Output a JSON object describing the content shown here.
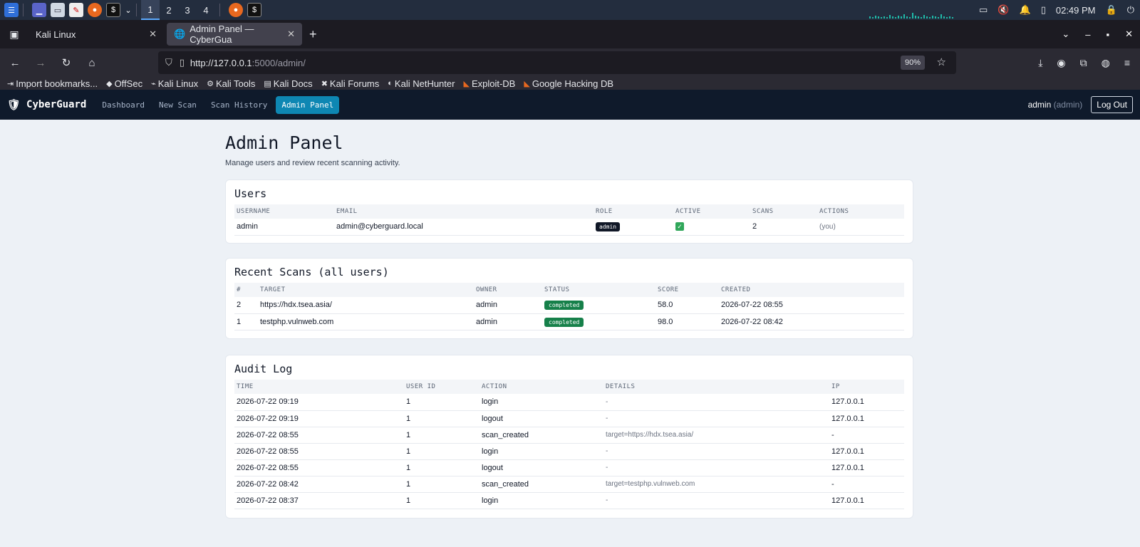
{
  "taskbar": {
    "workspaces": [
      "1",
      "2",
      "3",
      "4"
    ],
    "clock": "02:49 PM",
    "icons": [
      "kali-menu-icon",
      "desktop-icon",
      "file-manager-icon",
      "text-editor-icon",
      "firefox-icon",
      "terminal-icon"
    ]
  },
  "browser": {
    "tabs": [
      {
        "title": "Kali Linux"
      },
      {
        "title": "Admin Panel — CyberGua"
      }
    ],
    "url_host": "http://127.0.0.1",
    "url_rest": ":5000/admin/",
    "zoom": "90%",
    "bookmarks": [
      "Import bookmarks...",
      "OffSec",
      "Kali Linux",
      "Kali Tools",
      "Kali Docs",
      "Kali Forums",
      "Kali NetHunter",
      "Exploit-DB",
      "Google Hacking DB"
    ]
  },
  "app": {
    "brand": "CyberGuard",
    "nav": [
      "Dashboard",
      "New Scan",
      "Scan History",
      "Admin Panel"
    ],
    "user": "admin",
    "user_role": "(admin)",
    "logout": "Log Out"
  },
  "page": {
    "title": "Admin Panel",
    "subtitle": "Manage users and review recent scanning activity."
  },
  "users": {
    "heading": "Users",
    "columns": [
      "USERNAME",
      "EMAIL",
      "ROLE",
      "ACTIVE",
      "SCANS",
      "ACTIONS"
    ],
    "rows": [
      {
        "username": "admin",
        "email": "admin@cyberguard.local",
        "role": "admin",
        "active": "✓",
        "scans": "2",
        "actions": "(you)"
      }
    ]
  },
  "scans": {
    "heading": "Recent Scans (all users)",
    "columns": [
      "#",
      "TARGET",
      "OWNER",
      "STATUS",
      "SCORE",
      "CREATED"
    ],
    "rows": [
      {
        "id": "2",
        "target": "https://hdx.tsea.asia/",
        "owner": "admin",
        "status": "completed",
        "score": "58.0",
        "created": "2026-07-22 08:55"
      },
      {
        "id": "1",
        "target": "testphp.vulnweb.com",
        "owner": "admin",
        "status": "completed",
        "score": "98.0",
        "created": "2026-07-22 08:42"
      }
    ]
  },
  "audit": {
    "heading": "Audit Log",
    "columns": [
      "TIME",
      "USER ID",
      "ACTION",
      "DETAILS",
      "IP"
    ],
    "rows": [
      {
        "time": "2026-07-22 09:19",
        "user_id": "1",
        "action": "login",
        "details": "-",
        "ip": "127.0.0.1"
      },
      {
        "time": "2026-07-22 09:19",
        "user_id": "1",
        "action": "logout",
        "details": "-",
        "ip": "127.0.0.1"
      },
      {
        "time": "2026-07-22 08:55",
        "user_id": "1",
        "action": "scan_created",
        "details": "target=https://hdx.tsea.asia/",
        "ip": "-"
      },
      {
        "time": "2026-07-22 08:55",
        "user_id": "1",
        "action": "login",
        "details": "-",
        "ip": "127.0.0.1"
      },
      {
        "time": "2026-07-22 08:55",
        "user_id": "1",
        "action": "logout",
        "details": "-",
        "ip": "127.0.0.1"
      },
      {
        "time": "2026-07-22 08:42",
        "user_id": "1",
        "action": "scan_created",
        "details": "target=testphp.vulnweb.com",
        "ip": "-"
      },
      {
        "time": "2026-07-22 08:37",
        "user_id": "1",
        "action": "login",
        "details": "-",
        "ip": "127.0.0.1"
      }
    ]
  }
}
